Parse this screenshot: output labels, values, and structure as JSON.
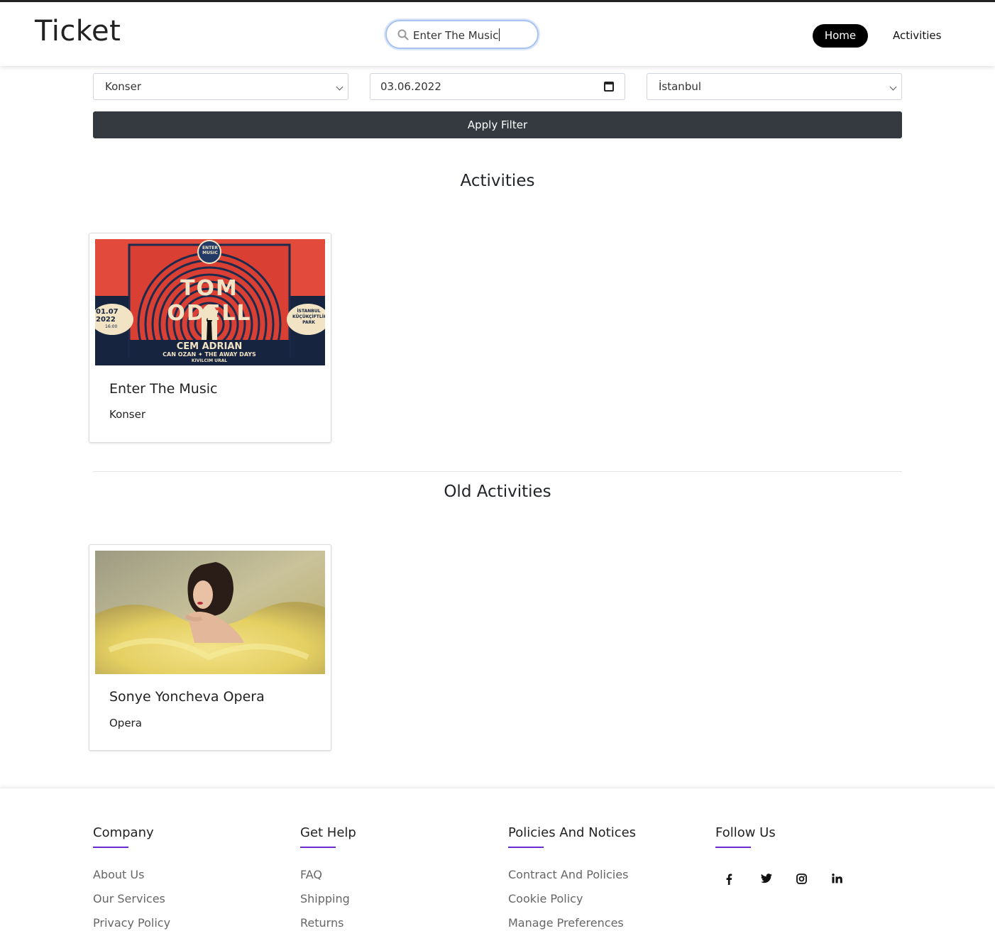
{
  "header": {
    "brand": "Ticket",
    "search_value": "Enter The Music",
    "nav": {
      "home": "Home",
      "activities": "Activities"
    }
  },
  "filters": {
    "category": "Konser",
    "date": "03.06.2022",
    "city": "İstanbul",
    "apply_label": "Apply Filter"
  },
  "activities": {
    "title": "Activities",
    "cards": [
      {
        "title": "Enter The Music",
        "category": "Konser",
        "poster": {
          "date": "01.07 2022",
          "time": "16:00",
          "headliner": "TOM ODELL",
          "lineup1": "CEM ADRIAN",
          "lineup2": "CAN OZAN ✦ THE AWAY DAYS",
          "lineup3": "KIVILCIM URAL",
          "venue": "İSTANBUL KÜÇÜKÇİFTLİK PARK",
          "badge": "ENTER MUSIC"
        }
      }
    ]
  },
  "old_activities": {
    "title": "Old Activities",
    "cards": [
      {
        "title": "Sonye Yoncheva Opera",
        "category": "Opera"
      }
    ]
  },
  "footer": {
    "company": {
      "title": "Company",
      "links": [
        "About Us",
        "Our Services",
        "Privacy Policy"
      ]
    },
    "help": {
      "title": "Get Help",
      "links": [
        "FAQ",
        "Shipping",
        "Returns"
      ]
    },
    "policies": {
      "title": "Policies And Notices",
      "links": [
        "Contract And Policies",
        "Cookie Policy",
        "Manage Preferences"
      ]
    },
    "follow": {
      "title": "Follow Us",
      "icons": [
        "facebook-icon",
        "twitter-icon",
        "instagram-icon",
        "linkedin-icon"
      ]
    }
  },
  "colors": {
    "accent_underline": "#6a2bd0",
    "button_dark": "#343a40",
    "nav_active": "#000000"
  }
}
